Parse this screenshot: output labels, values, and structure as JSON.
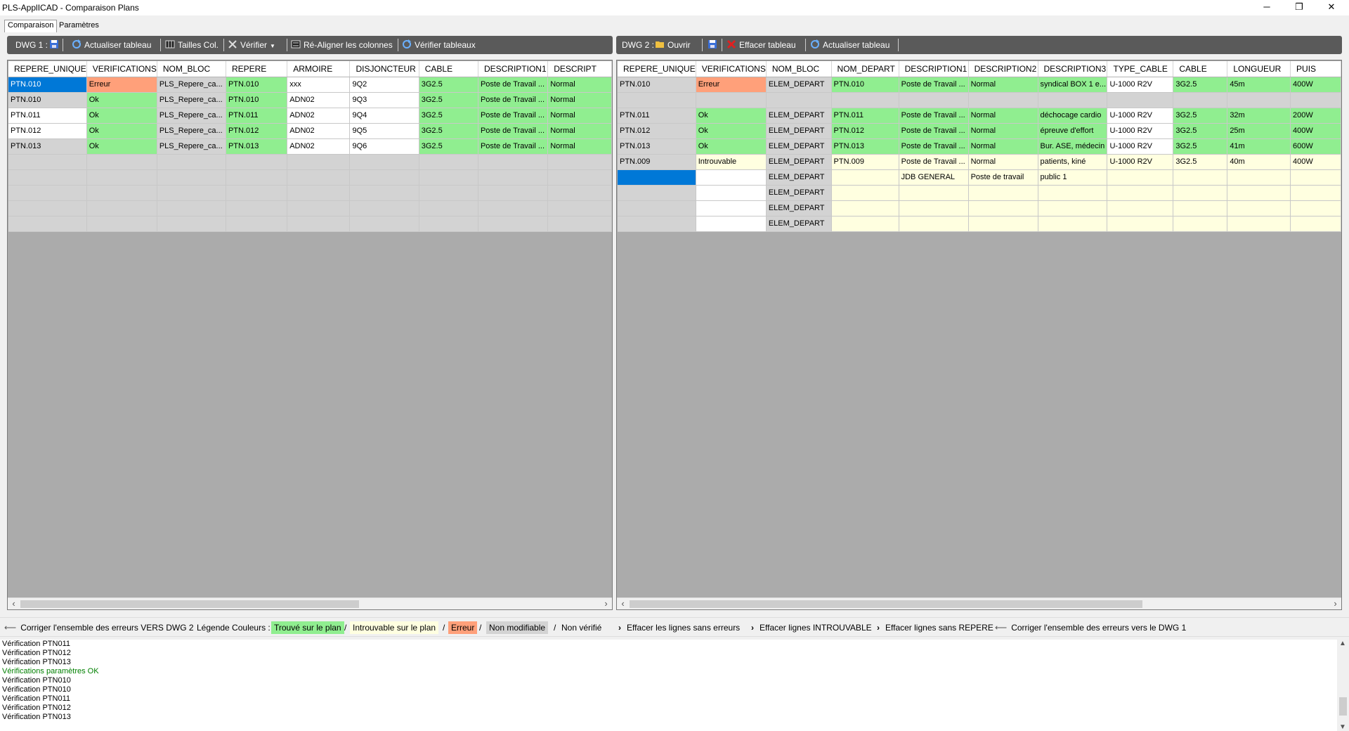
{
  "window": {
    "title": "PLS-ApplICAD - Comparaison Plans",
    "minimize": "─",
    "restore": "❐",
    "close": "✕"
  },
  "tabs": [
    {
      "label": "Comparaison"
    },
    {
      "label": "Paramètres"
    }
  ],
  "toolbar1": {
    "dwg_label": "DWG 1 :",
    "refresh": "Actualiser tableau",
    "sizes": "Tailles Col.",
    "verify": "Vérifier",
    "realign": "Ré-Aligner les colonnes",
    "verify_tables": "Vérifier tableaux"
  },
  "toolbar2": {
    "dwg_label": "DWG 2 :",
    "open": "Ouvrir",
    "clear": "Effacer tableau",
    "refresh": "Actualiser tableau"
  },
  "colors": {
    "found": "#90ee90",
    "notfound": "#ffffe0",
    "error": "#ffa07a",
    "readonly": "#d3d3d3",
    "unchecked": "#ffffff",
    "selected": "#0078d7"
  },
  "grid1": {
    "columns": [
      "REPERE_UNIQUE",
      "VERIFICATIONS",
      "NOM_BLOC",
      "REPERE",
      "ARMOIRE",
      "DISJONCTEUR",
      "CABLE",
      "DESCRIPTION1",
      "DESCRIPT"
    ],
    "rows": [
      {
        "cells": [
          "PTN.010",
          "Erreur",
          "PLS_Repere_ca...",
          "PTN.010",
          "xxx",
          "9Q2",
          "3G2.5",
          "Poste de Travail ...",
          "Normal"
        ],
        "colors": [
          "selected",
          "error",
          "readonly",
          "found",
          "unchecked",
          "unchecked",
          "found",
          "found",
          "found"
        ]
      },
      {
        "cells": [
          "PTN.010",
          "Ok",
          "PLS_Repere_ca...",
          "PTN.010",
          "ADN02",
          "9Q3",
          "3G2.5",
          "Poste de Travail ...",
          "Normal"
        ],
        "colors": [
          "readonly",
          "found",
          "readonly",
          "found",
          "unchecked",
          "unchecked",
          "found",
          "found",
          "found"
        ]
      },
      {
        "cells": [
          "PTN.011",
          "Ok",
          "PLS_Repere_ca...",
          "PTN.011",
          "ADN02",
          "9Q4",
          "3G2.5",
          "Poste de Travail ...",
          "Normal"
        ],
        "colors": [
          "unchecked",
          "found",
          "readonly",
          "found",
          "unchecked",
          "unchecked",
          "found",
          "found",
          "found"
        ]
      },
      {
        "cells": [
          "PTN.012",
          "Ok",
          "PLS_Repere_ca...",
          "PTN.012",
          "ADN02",
          "9Q5",
          "3G2.5",
          "Poste de Travail ...",
          "Normal"
        ],
        "colors": [
          "unchecked",
          "found",
          "readonly",
          "found",
          "unchecked",
          "unchecked",
          "found",
          "found",
          "found"
        ]
      },
      {
        "cells": [
          "PTN.013",
          "Ok",
          "PLS_Repere_ca...",
          "PTN.013",
          "ADN02",
          "9Q6",
          "3G2.5",
          "Poste de Travail ...",
          "Normal"
        ],
        "colors": [
          "readonly",
          "found",
          "readonly",
          "found",
          "unchecked",
          "unchecked",
          "found",
          "found",
          "found"
        ]
      },
      {
        "cells": [
          "",
          "",
          "",
          "",
          "",
          "",
          "",
          "",
          ""
        ],
        "colors": [
          "readonly",
          "readonly",
          "readonly",
          "readonly",
          "readonly",
          "readonly",
          "readonly",
          "readonly",
          "readonly"
        ]
      },
      {
        "cells": [
          "",
          "",
          "",
          "",
          "",
          "",
          "",
          "",
          ""
        ],
        "colors": [
          "readonly",
          "readonly",
          "readonly",
          "readonly",
          "readonly",
          "readonly",
          "readonly",
          "readonly",
          "readonly"
        ]
      },
      {
        "cells": [
          "",
          "",
          "",
          "",
          "",
          "",
          "",
          "",
          ""
        ],
        "colors": [
          "readonly",
          "readonly",
          "readonly",
          "readonly",
          "readonly",
          "readonly",
          "readonly",
          "readonly",
          "readonly"
        ]
      },
      {
        "cells": [
          "",
          "",
          "",
          "",
          "",
          "",
          "",
          "",
          ""
        ],
        "colors": [
          "readonly",
          "readonly",
          "readonly",
          "readonly",
          "readonly",
          "readonly",
          "readonly",
          "readonly",
          "readonly"
        ]
      },
      {
        "cells": [
          "",
          "",
          "",
          "",
          "",
          "",
          "",
          "",
          ""
        ],
        "colors": [
          "readonly",
          "readonly",
          "readonly",
          "readonly",
          "readonly",
          "readonly",
          "readonly",
          "readonly",
          "readonly"
        ]
      }
    ]
  },
  "grid2": {
    "columns": [
      "REPERE_UNIQUE",
      "VERIFICATIONS",
      "NOM_BLOC",
      "NOM_DEPART",
      "DESCRIPTION1",
      "DESCRIPTION2",
      "DESCRIPTION3",
      "TYPE_CABLE",
      "CABLE",
      "LONGUEUR",
      "PUIS"
    ],
    "rows": [
      {
        "cells": [
          "PTN.010",
          "Erreur",
          "ELEM_DEPART",
          "PTN.010",
          "Poste de Travail ...",
          "Normal",
          "syndical BOX 1 e...",
          "U-1000 R2V",
          "3G2.5",
          "45m",
          "400W"
        ],
        "colors": [
          "readonly",
          "error",
          "readonly",
          "found",
          "found",
          "found",
          "found",
          "unchecked",
          "found",
          "found",
          "found"
        ]
      },
      {
        "cells": [
          "",
          "",
          "",
          "",
          "",
          "",
          "",
          "",
          "",
          "",
          ""
        ],
        "colors": [
          "readonly",
          "readonly",
          "readonly",
          "readonly",
          "readonly",
          "readonly",
          "readonly",
          "readonly",
          "readonly",
          "readonly",
          "readonly"
        ]
      },
      {
        "cells": [
          "PTN.011",
          "Ok",
          "ELEM_DEPART",
          "PTN.011",
          "Poste de Travail ...",
          "Normal",
          "déchocage cardio",
          "U-1000 R2V",
          "3G2.5",
          "32m",
          "200W"
        ],
        "colors": [
          "readonly",
          "found",
          "readonly",
          "found",
          "found",
          "found",
          "found",
          "unchecked",
          "found",
          "found",
          "found"
        ]
      },
      {
        "cells": [
          "PTN.012",
          "Ok",
          "ELEM_DEPART",
          "PTN.012",
          "Poste de Travail ...",
          "Normal",
          "épreuve d'effort",
          "U-1000 R2V",
          "3G2.5",
          "25m",
          "400W"
        ],
        "colors": [
          "readonly",
          "found",
          "readonly",
          "found",
          "found",
          "found",
          "found",
          "unchecked",
          "found",
          "found",
          "found"
        ]
      },
      {
        "cells": [
          "PTN.013",
          "Ok",
          "ELEM_DEPART",
          "PTN.013",
          "Poste de Travail ...",
          "Normal",
          "Bur. ASE, médecin",
          "U-1000 R2V",
          "3G2.5",
          "41m",
          "600W"
        ],
        "colors": [
          "readonly",
          "found",
          "readonly",
          "found",
          "found",
          "found",
          "found",
          "unchecked",
          "found",
          "found",
          "found"
        ]
      },
      {
        "cells": [
          "PTN.009",
          "Introuvable",
          "ELEM_DEPART",
          "PTN.009",
          "Poste de Travail ...",
          "Normal",
          "patients, kiné",
          "U-1000 R2V",
          "3G2.5",
          "40m",
          "400W"
        ],
        "colors": [
          "readonly",
          "notfound",
          "readonly",
          "notfound",
          "notfound",
          "notfound",
          "notfound",
          "notfound",
          "notfound",
          "notfound",
          "notfound"
        ]
      },
      {
        "cells": [
          "",
          "",
          "ELEM_DEPART",
          "",
          "JDB GENERAL",
          "Poste de travail",
          "public 1",
          "",
          "",
          "",
          ""
        ],
        "colors": [
          "selected",
          "unchecked",
          "readonly",
          "notfound",
          "notfound",
          "notfound",
          "notfound",
          "notfound",
          "notfound",
          "notfound",
          "notfound"
        ]
      },
      {
        "cells": [
          "",
          "",
          "ELEM_DEPART",
          "",
          "",
          "",
          "",
          "",
          "",
          "",
          ""
        ],
        "colors": [
          "readonly",
          "unchecked",
          "readonly",
          "notfound",
          "notfound",
          "notfound",
          "notfound",
          "notfound",
          "notfound",
          "notfound",
          "notfound"
        ]
      },
      {
        "cells": [
          "",
          "",
          "ELEM_DEPART",
          "",
          "",
          "",
          "",
          "",
          "",
          "",
          ""
        ],
        "colors": [
          "readonly",
          "unchecked",
          "readonly",
          "notfound",
          "notfound",
          "notfound",
          "notfound",
          "notfound",
          "notfound",
          "notfound",
          "notfound"
        ]
      },
      {
        "cells": [
          "",
          "",
          "ELEM_DEPART",
          "",
          "",
          "",
          "",
          "",
          "",
          "",
          ""
        ],
        "colors": [
          "readonly",
          "unchecked",
          "readonly",
          "notfound",
          "notfound",
          "notfound",
          "notfound",
          "notfound",
          "notfound",
          "notfound",
          "notfound"
        ]
      }
    ]
  },
  "statusbar": {
    "fix_to_dwg2": "Corriger l'ensemble des erreurs VERS DWG 2",
    "legend_label": "Légende Couleurs :",
    "legend_found": "Trouvé sur le plan",
    "legend_notfound": "Introuvable sur le plan",
    "legend_error": "Erreur",
    "legend_readonly": "Non modifiable",
    "legend_unchecked": "Non vérifié",
    "slash": "/",
    "clear_no_errors": "Effacer les lignes sans erreurs",
    "clear_notfound": "Effacer lignes INTROUVABLE",
    "clear_no_repere": "Effacer lignes sans REPERE",
    "fix_to_dwg1": "Corriger l'ensemble des erreurs vers le DWG 1"
  },
  "log": [
    {
      "text": "Vérification PTN011",
      "color": "#000000"
    },
    {
      "text": "Vérification PTN012",
      "color": "#000000"
    },
    {
      "text": "Vérification PTN013",
      "color": "#000000"
    },
    {
      "text": "Vérifications paramètres OK",
      "color": "#008000"
    },
    {
      "text": "Vérification PTN010",
      "color": "#000000"
    },
    {
      "text": "Vérification PTN010",
      "color": "#000000"
    },
    {
      "text": "Vérification PTN011",
      "color": "#000000"
    },
    {
      "text": "Vérification PTN012",
      "color": "#000000"
    },
    {
      "text": "Vérification PTN013",
      "color": "#000000"
    }
  ]
}
